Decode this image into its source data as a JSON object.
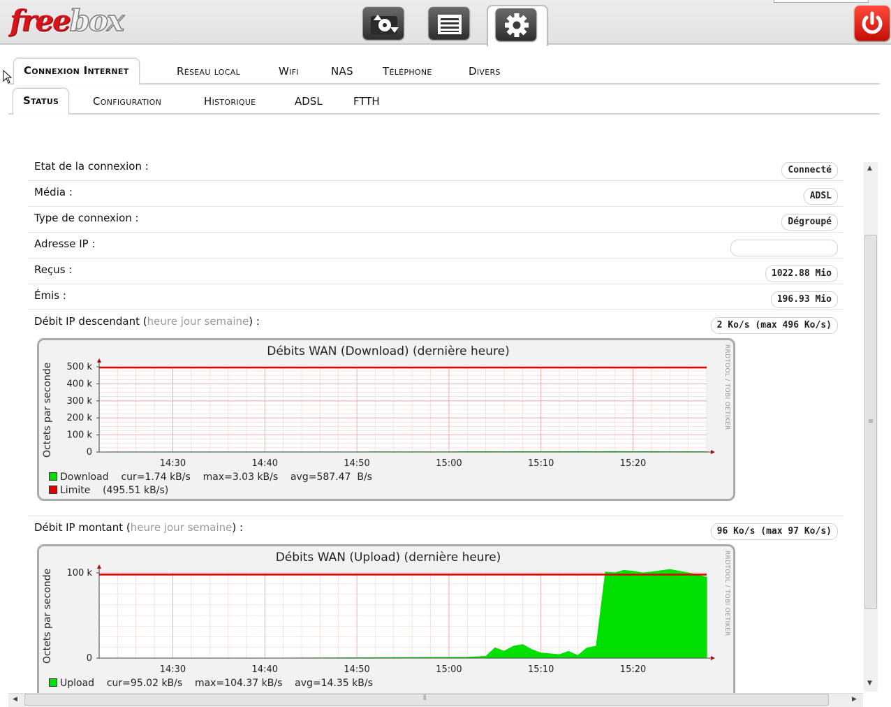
{
  "header": {
    "logo_part1": "free",
    "logo_part2": "box",
    "colors": {
      "brand_red": "#d7141a",
      "power_red": "#e8241a"
    },
    "icons": [
      "upload-download-icon",
      "list-icon",
      "gear-icon",
      "power-icon"
    ]
  },
  "tabs": [
    {
      "label": "Connexion Internet",
      "active": true
    },
    {
      "label": "Réseau local",
      "active": false
    },
    {
      "label": "Wifi",
      "active": false
    },
    {
      "label": "NAS",
      "active": false
    },
    {
      "label": "Téléphone",
      "active": false
    },
    {
      "label": "Divers",
      "active": false
    }
  ],
  "subtabs": [
    {
      "label": "Status",
      "active": true
    },
    {
      "label": "Configuration",
      "active": false
    },
    {
      "label": "Historique",
      "active": false
    },
    {
      "label": "ADSL",
      "active": false
    },
    {
      "label": "FTTH",
      "active": false
    }
  ],
  "status": {
    "etat": {
      "label": "Etat de la connexion :",
      "value": "Connecté"
    },
    "media": {
      "label": "Média :",
      "value": "ADSL"
    },
    "type": {
      "label": "Type de connexion :",
      "value": "Dégroupé"
    },
    "ip": {
      "label": "Adresse IP :",
      "value": ""
    },
    "recus": {
      "label": "Reçus :",
      "value": "1022.88 Mio"
    },
    "emis": {
      "label": "Émis :",
      "value": "196.93 Mio"
    },
    "down": {
      "label": "Débit IP descendant",
      "link": "heure jour semaine",
      "open": " (",
      "close": ") :",
      "value": "2 Ko/s (max 496 Ko/s)"
    },
    "up": {
      "label": "Débit IP montant",
      "link": "heure jour semaine",
      "open": " (",
      "close": ") :",
      "value": "96 Ko/s (max 97 Ko/s)"
    }
  },
  "graphs": {
    "watermark": "RRDTOOL / TOBI OETIKER",
    "ylabel": "Octets par seconde",
    "download": {
      "title": "Débits WAN (Download)  (dernière heure)",
      "legend1": "Download    cur=1.74 kB/s    max=3.03 kB/s    avg=587.47  B/s",
      "legend2": "Limite    (495.51 kB/s)"
    },
    "upload": {
      "title": "Débits WAN (Upload)  (dernière heure)",
      "legend1": "Upload    cur=95.02 kB/s    max=104.37 kB/s    avg=14.35 kB/s"
    }
  },
  "chart_data": [
    {
      "type": "area",
      "title": "Débits WAN (Download)  (dernière heure)",
      "ylabel": "Octets par seconde",
      "xlabel": "",
      "xticks": [
        "14:30",
        "14:40",
        "14:50",
        "15:00",
        "15:10",
        "15:20"
      ],
      "yticks": [
        "0",
        "100 k",
        "200 k",
        "300 k",
        "400 k",
        "500 k"
      ],
      "ylim": [
        0,
        500
      ],
      "y_unit": "kB/s",
      "x_minutes_after_1422": [
        0,
        10,
        20,
        30,
        38,
        40,
        42,
        44,
        46,
        48,
        50,
        52,
        54,
        56,
        58,
        60,
        62,
        64,
        66
      ],
      "series": [
        {
          "name": "Download",
          "color": "#00e000",
          "values": [
            0,
            0.5,
            0.6,
            0.8,
            1.2,
            1.8,
            2.0,
            1.5,
            2.5,
            1.8,
            2.2,
            2.8,
            1.9,
            3.0,
            2.1,
            2.4,
            1.7,
            2.0,
            1.74
          ]
        },
        {
          "name": "Limite",
          "color": "#e00000",
          "constant": 495.51
        }
      ],
      "grid": true
    },
    {
      "type": "area",
      "title": "Débits WAN (Upload)  (dernière heure)",
      "ylabel": "Octets par seconde",
      "xlabel": "",
      "xticks": [
        "14:30",
        "14:40",
        "14:50",
        "15:00",
        "15:10",
        "15:20"
      ],
      "yticks": [
        "0",
        "100 k"
      ],
      "ylim": [
        0,
        100
      ],
      "y_unit": "kB/s",
      "x_minutes_after_1422": [
        0,
        20,
        40,
        42,
        43,
        44,
        45,
        46,
        47,
        48,
        49,
        50,
        51,
        52,
        53,
        54,
        55,
        56,
        57,
        58,
        59,
        60,
        62,
        64,
        66
      ],
      "series": [
        {
          "name": "Upload",
          "color": "#00e000",
          "values": [
            0,
            0,
            1,
            2,
            12,
            8,
            14,
            16,
            10,
            6,
            5,
            4,
            8,
            3,
            12,
            14,
            101,
            100,
            103,
            102,
            100,
            101,
            104,
            100,
            95
          ]
        },
        {
          "name": "Limite",
          "color": "#e00000",
          "constant": 98
        }
      ],
      "grid": true
    }
  ]
}
